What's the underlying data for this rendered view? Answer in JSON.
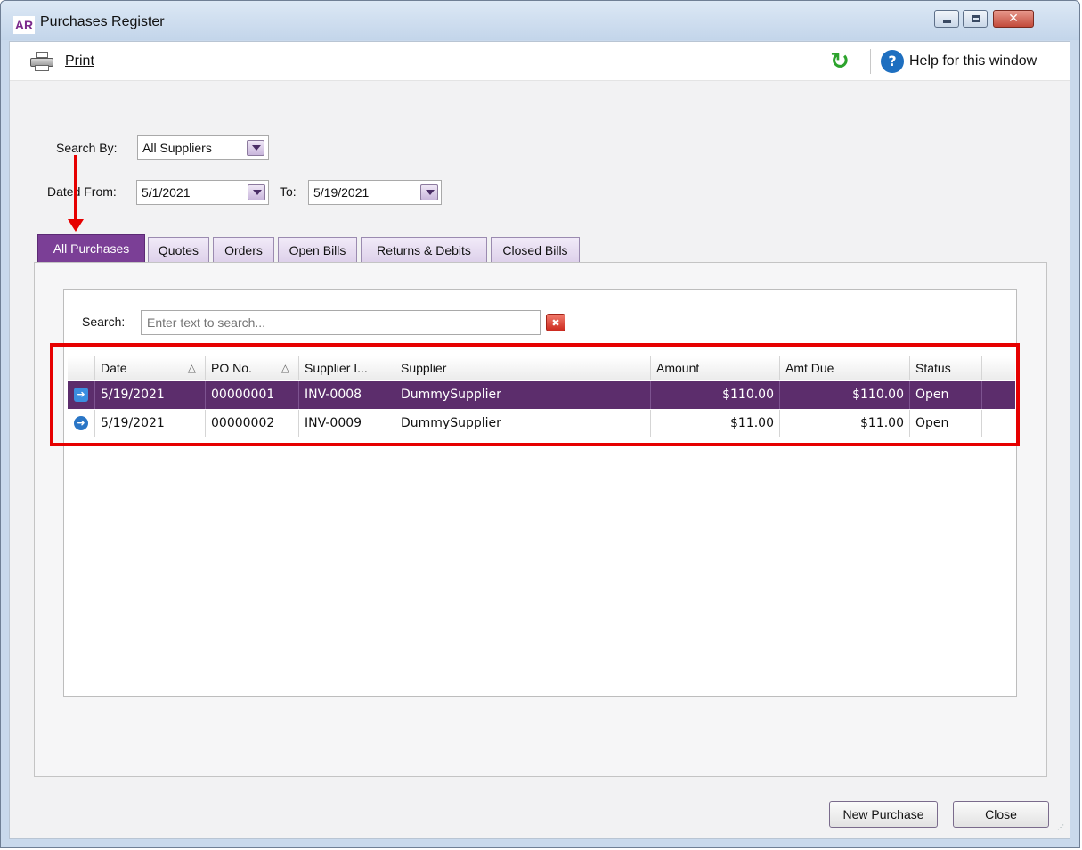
{
  "window": {
    "app_badge": "AR",
    "title": "Purchases Register",
    "close_glyph": "✕"
  },
  "toolbar": {
    "print_label": "Print",
    "help_label": "Help for this window",
    "refresh_icon": "refresh-icon",
    "help_icon": "?"
  },
  "filters": {
    "search_by_label": "Search By:",
    "search_by_value": "All Suppliers",
    "dated_from_label": "Dated From:",
    "dated_from_value": "5/1/2021",
    "to_label": "To:",
    "to_value": "5/19/2021"
  },
  "tabs": [
    {
      "label": "All Purchases",
      "active": true
    },
    {
      "label": "Quotes",
      "active": false
    },
    {
      "label": "Orders",
      "active": false
    },
    {
      "label": "Open Bills",
      "active": false
    },
    {
      "label": "Returns & Debits",
      "active": false
    },
    {
      "label": "Closed Bills",
      "active": false
    }
  ],
  "search": {
    "label": "Search:",
    "placeholder": "Enter text to search...",
    "clear_glyph": "✖"
  },
  "grid": {
    "columns": [
      "Date",
      "PO No.",
      "Supplier I...",
      "Supplier",
      "Amount",
      "Amt Due",
      "Status"
    ],
    "sort_glyph": "△",
    "row_glyph": "➜",
    "rows": [
      {
        "date": "5/19/2021",
        "po_no": "00000001",
        "supplier_inv": "INV-0008",
        "supplier": "DummySupplier",
        "amount": "$110.00",
        "amt_due": "$110.00",
        "status": "Open",
        "selected": true
      },
      {
        "date": "5/19/2021",
        "po_no": "00000002",
        "supplier_inv": "INV-0009",
        "supplier": "DummySupplier",
        "amount": "$11.00",
        "amt_due": "$11.00",
        "status": "Open",
        "selected": false
      }
    ]
  },
  "buttons": {
    "new_purchase": "New Purchase",
    "close": "Close"
  },
  "colors": {
    "accent": "#7b3f96",
    "selected_row": "#5c2d6c",
    "annotation": "#e60000"
  }
}
